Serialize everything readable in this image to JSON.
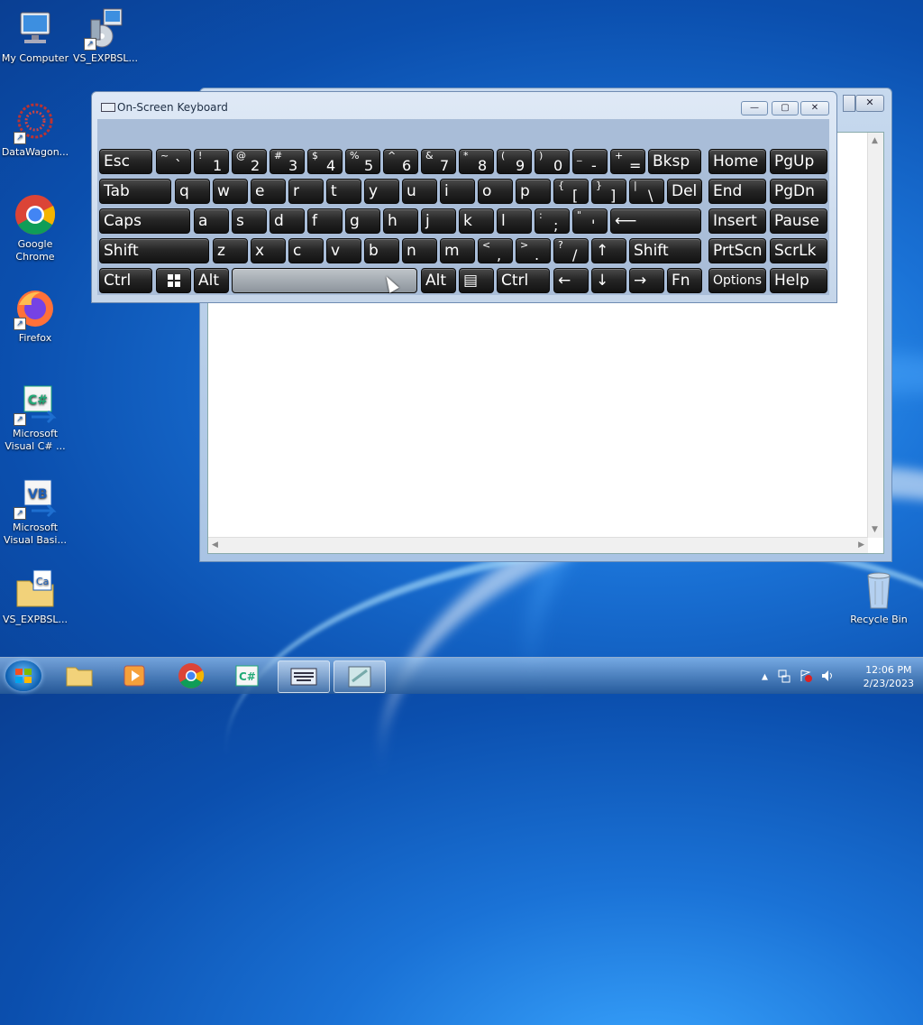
{
  "desktop": {
    "icons": [
      {
        "label": "My Computer",
        "icon": "computer-icon"
      },
      {
        "label": "VS_EXPBSL...",
        "icon": "installer-icon"
      },
      {
        "label": "DataWagon...",
        "icon": "datawagon-icon"
      },
      {
        "label": "Google Chrome",
        "icon": "chrome-icon"
      },
      {
        "label": "Firefox",
        "icon": "firefox-icon"
      },
      {
        "label": "Microsoft Visual C# ...",
        "icon": "visual-csharp-icon"
      },
      {
        "label": "Microsoft Visual Basi...",
        "icon": "visual-basic-icon"
      },
      {
        "label": "VS_EXPBSL...",
        "icon": "folder-icon"
      },
      {
        "label": "Recycle Bin",
        "icon": "recycle-bin-icon"
      }
    ]
  },
  "background_window": {
    "close_label": "✕",
    "scroll_up": "▲",
    "scroll_down": "▼",
    "scroll_left": "◀",
    "scroll_right": "▶"
  },
  "osk": {
    "title": "On-Screen Keyboard",
    "minimize": "—",
    "restore": "▢",
    "close": "✕",
    "keys": {
      "esc": "Esc",
      "tab": "Tab",
      "caps": "Caps",
      "shift": "Shift",
      "rshift": "Shift",
      "ctrl": "Ctrl",
      "alt": "Alt",
      "ralt": "Alt",
      "rctrl": "Ctrl",
      "fn": "Fn",
      "bksp": "Bksp",
      "del": "Del",
      "home": "Home",
      "pgup": "PgUp",
      "end": "End",
      "pgdn": "PgDn",
      "insert": "Insert",
      "pause": "Pause",
      "prtscn": "PrtScn",
      "scrlk": "ScrLk",
      "options": "Options",
      "help": "Help",
      "q": "q",
      "w": "w",
      "e": "e",
      "r": "r",
      "t": "t",
      "y": "y",
      "u": "u",
      "i": "i",
      "o": "o",
      "p": "p",
      "a": "a",
      "s": "s",
      "d": "d",
      "f": "f",
      "g": "g",
      "h": "h",
      "j": "j",
      "k": "k",
      "l": "l",
      "z": "z",
      "x": "x",
      "c": "c",
      "v": "v",
      "b": "b",
      "n": "n",
      "m": "m",
      "n1_top": "!",
      "n1": "1",
      "n2_top": "@",
      "n2": "2",
      "n3_top": "#",
      "n3": "3",
      "n4_top": "$",
      "n4": "4",
      "n5_top": "%",
      "n5": "5",
      "n6_top": "^",
      "n6": "6",
      "n7_top": "&",
      "n7": "7",
      "n8_top": "*",
      "n8": "8",
      "n9_top": "(",
      "n9": "9",
      "n0_top": ")",
      "n0": "0",
      "minus_top": "_",
      "minus": "-",
      "eq_top": "+",
      "eq": "=",
      "tilde_top": "~",
      "tilde": "`",
      "lbr_top": "{",
      "lbr": "[",
      "rbr_top": "}",
      "rbr": "]",
      "bs_top": "|",
      "bs": "\\",
      "semi_top": ":",
      "semi": ";",
      "quote_top": "\"",
      "quote": "'",
      "comma_top": "<",
      "comma": ",",
      "dot_top": ">",
      "dot": ".",
      "slash_top": "?",
      "slash": "/",
      "up": "↑",
      "left": "←",
      "down": "↓",
      "right": "→",
      "enter": "⟵",
      "menu": "▤"
    }
  },
  "taskbar": {
    "time": "12:06 PM",
    "date": "2/23/2023",
    "tray_arrow": "▲"
  }
}
